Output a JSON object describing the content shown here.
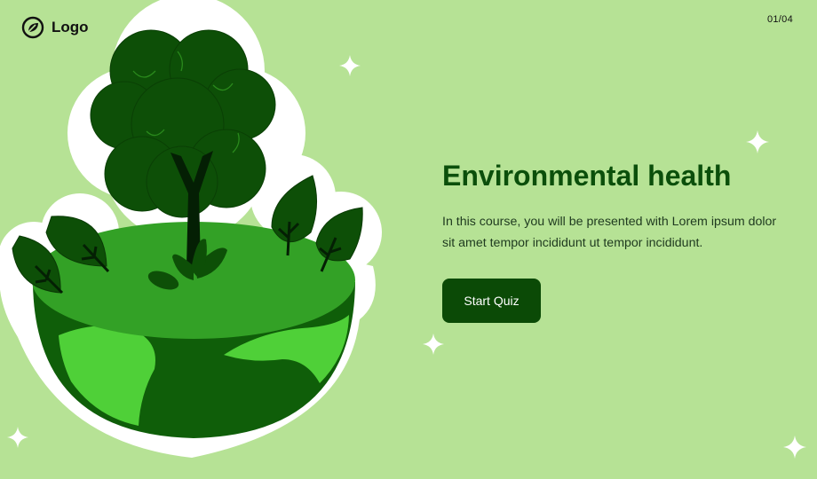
{
  "header": {
    "logo_text": "Logo",
    "page_counter": "01/04"
  },
  "main": {
    "title": "Environmental health",
    "description": "In this course, you will be presented with Lorem ipsum dolor sit amet  tempor incididunt ut tempor incididunt.",
    "start_button_label": "Start Quiz"
  },
  "colors": {
    "background": "#b6e295",
    "title": "#0b4f0b",
    "button_bg": "#0b4a06",
    "button_text": "#ffffff"
  },
  "icons": {
    "logo": "leaf-logo-icon",
    "illustration": "tree-on-globe-illustration",
    "decoration": "sparkle-icon"
  }
}
